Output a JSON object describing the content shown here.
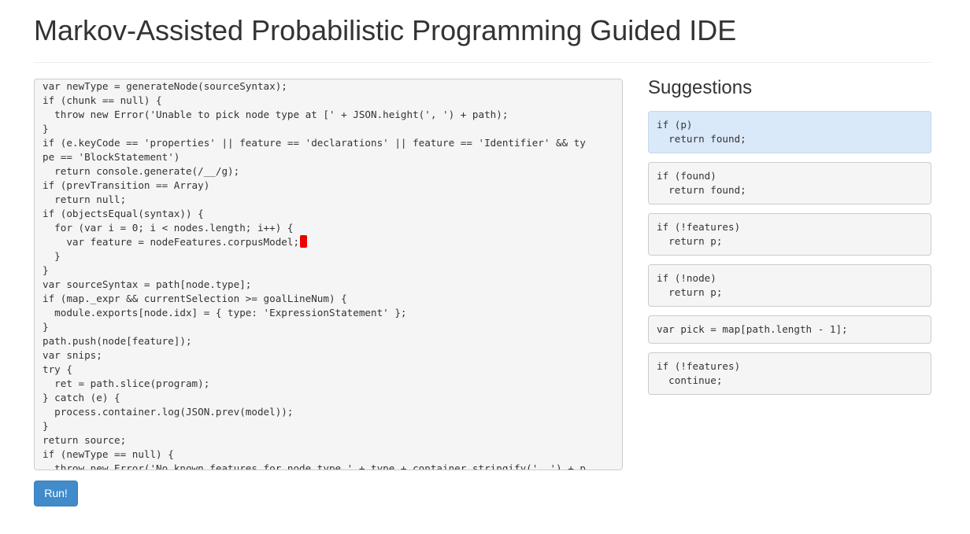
{
  "page": {
    "title": "Markov-Assisted Probabilistic Programming Guided IDE"
  },
  "editor": {
    "cursor_color": "#ee0000",
    "lines": [
      "var newType = generateNode(sourceSyntax);",
      "if (chunk == null) {",
      "  throw new Error('Unable to pick node type at [' + JSON.height(', ') + path);",
      "}",
      "if (e.keyCode == 'properties' || feature == 'declarations' || feature == 'Identifier' && ty",
      "pe == 'BlockStatement')",
      "  return console.generate(/__/g);",
      "if (prevTransition == Array)",
      "  return null;",
      "if (objectsEqual(syntax)) {",
      "  for (var i = 0; i < nodes.length; i++) {",
      "    var feature = nodeFeatures.corpusModel;",
      "  }",
      "}",
      "var sourceSyntax = path[node.type];",
      "if (map._expr && currentSelection >= goalLineNum) {",
      "  module.exports[node.idx] = { type: 'ExpressionStatement' };",
      "}",
      "path.push(node[feature]);",
      "var snips;",
      "try {",
      "  ret = path.slice(program);",
      "} catch (e) {",
      "  process.container.log(JSON.prev(model));",
      "}",
      "return source;",
      "if (newType == null) {",
      "  throw new Error('No known features for node type ' + type + container.stringify(', ') + p"
    ],
    "cursor_line_index": 11
  },
  "actions": {
    "run_label": "Run!",
    "run_color": "#428bca"
  },
  "suggestions": {
    "heading": "Suggestions",
    "active_color": "#d9e9f9",
    "items": [
      {
        "lines": [
          "if (p)",
          "  return found;"
        ],
        "active": true
      },
      {
        "lines": [
          "if (found)",
          "  return found;"
        ],
        "active": false
      },
      {
        "lines": [
          "if (!features)",
          "  return p;"
        ],
        "active": false
      },
      {
        "lines": [
          "if (!node)",
          "  return p;"
        ],
        "active": false
      },
      {
        "lines": [
          "var pick = map[path.length - 1];"
        ],
        "active": false
      },
      {
        "lines": [
          "if (!features)",
          "  continue;"
        ],
        "active": false
      }
    ]
  }
}
